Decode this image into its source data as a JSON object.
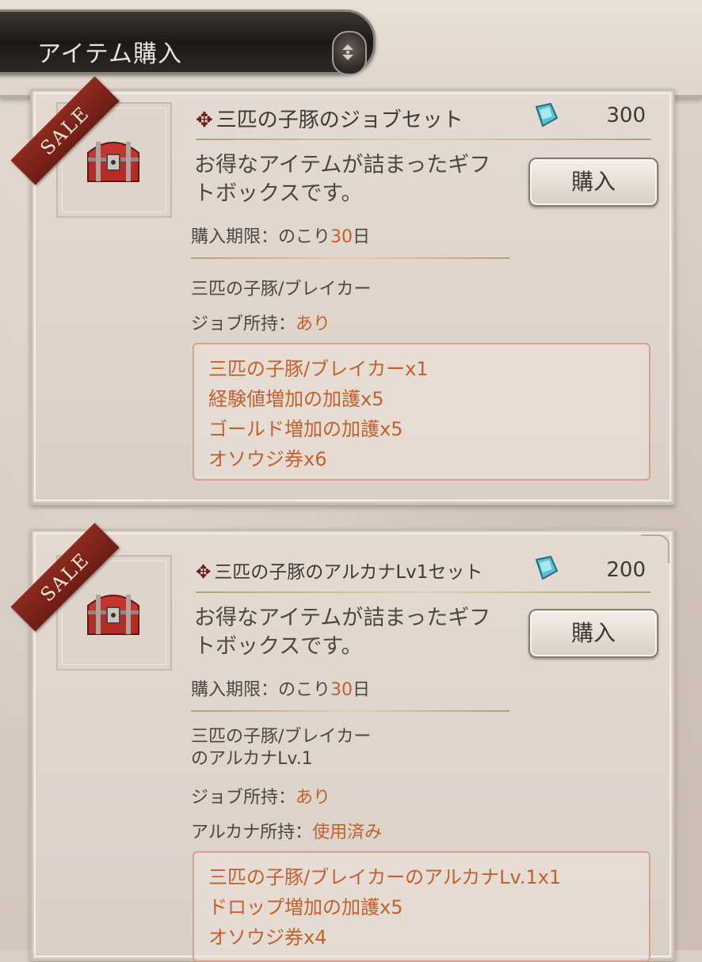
{
  "header": {
    "title": "アイテム購入"
  },
  "items": [
    {
      "ribbon": "SALE",
      "name": "三匹の子豚のジョブセット",
      "price": "300",
      "description_line1": "お得なアイテムが詰まったギフ",
      "description_line2": "トボックスです。",
      "buy_label": "購入",
      "deadline_prefix": "購入期限：のこり",
      "deadline_days": "30",
      "deadline_suffix": "日",
      "job_name": "三匹の子豚/ブレイカー",
      "job_owned_label": "ジョブ所持：",
      "job_owned_value": "あり",
      "contents": [
        "三匹の子豚/ブレイカーx1",
        "経験値増加の加護x5",
        "ゴールド増加の加護x5",
        "オソウジ券x6"
      ]
    },
    {
      "ribbon": "SALE",
      "name": "三匹の子豚のアルカナLv1セット",
      "price": "200",
      "description_line1": "お得なアイテムが詰まったギフ",
      "description_line2": "トボックスです。",
      "buy_label": "購入",
      "deadline_prefix": "購入期限：のこり",
      "deadline_days": "30",
      "deadline_suffix": "日",
      "job_name_line1": "三匹の子豚/ブレイカー",
      "job_name_line2": "のアルカナLv.1",
      "job_owned_label": "ジョブ所持：",
      "job_owned_value": "あり",
      "arcana_owned_label": "アルカナ所持：",
      "arcana_owned_value": "使用済み",
      "contents": [
        "三匹の子豚/ブレイカーのアルカナLv.1x1",
        "ドロップ増加の加護x5",
        "オソウジ券x4"
      ]
    }
  ],
  "colors": {
    "accent": "#c4602c",
    "ribbon": "#7a2219",
    "title_plate": "#1f1c1a"
  },
  "icons": [
    "treasure-chest-icon",
    "gem-currency-icon",
    "cross-ornament-icon",
    "scroll-arrows-icon"
  ]
}
